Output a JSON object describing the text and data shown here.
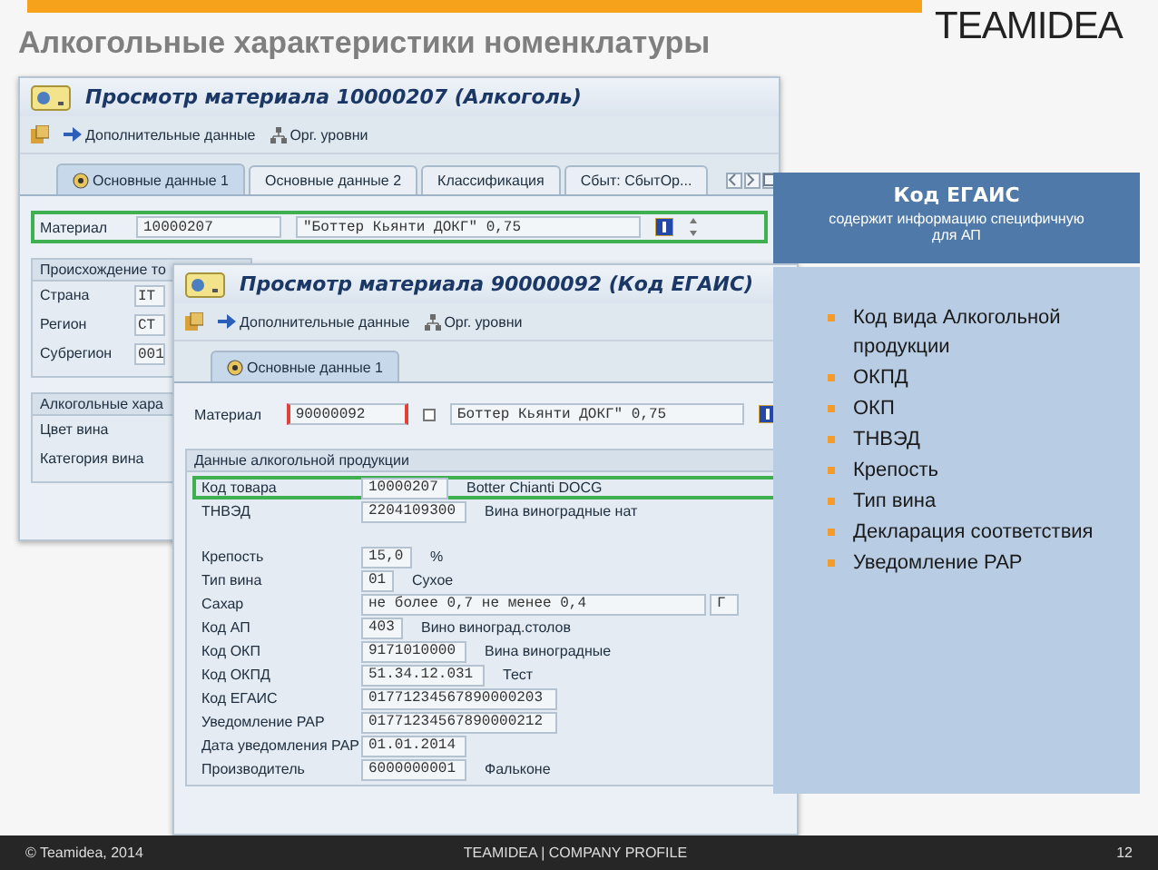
{
  "slide": {
    "title": "Алкогольные характеристики номенклатуры",
    "logo": "TEAMIDEA"
  },
  "back_window": {
    "title": "Просмотр материала 10000207 (Алкоголь)",
    "toolbar": [
      {
        "label": "Дополнительные данные"
      },
      {
        "label": "Орг. уровни"
      }
    ],
    "tabs": [
      {
        "label": "Основные данные 1",
        "selected": true
      },
      {
        "label": "Основные данные 2",
        "selected": false
      },
      {
        "label": "Классификация",
        "selected": false
      },
      {
        "label": "Сбыт: СбытОр...",
        "selected": false
      }
    ],
    "material": {
      "label": "Материал",
      "number": "10000207",
      "description": "\"Боттер Кьянти ДОКГ\" 0,75",
      "highlighted": true
    },
    "groups": [
      {
        "title": "Происхождение то",
        "fields": [
          {
            "label": "Страна",
            "value": "IT"
          },
          {
            "label": "Регион",
            "value": "CT"
          },
          {
            "label": "Субрегион",
            "value": "001"
          }
        ]
      },
      {
        "title": "Алкогольные хара",
        "fields": [
          {
            "label": "Цвет вина"
          },
          {
            "label": "Категория вина"
          }
        ]
      }
    ]
  },
  "front_window": {
    "title": "Просмотр материала 90000092 (Код ЕГАИС)",
    "toolbar": [
      {
        "label": "Дополнительные данные"
      },
      {
        "label": "Орг. уровни"
      }
    ],
    "tabs": [
      {
        "label": "Основные данные 1",
        "selected": true
      }
    ],
    "material": {
      "label": "Материал",
      "number": "90000092",
      "description": "Боттер Кьянти ДОКГ\" 0,75",
      "highlighted": false
    },
    "group": {
      "title": "Данные алкогольной продукции",
      "fields": [
        {
          "label": "Код товара",
          "value": "10000207",
          "text": "Botter Chianti DOCG",
          "highlighted": true
        },
        {
          "label": "ТНВЭД",
          "value": "2204109300",
          "text": "Вина виноградные нат",
          "highlighted": false
        },
        {
          "label": "Крепость",
          "value": "15,0",
          "text": "%",
          "highlighted": false,
          "gap_before": true
        },
        {
          "label": "Тип вина",
          "value": "01",
          "text": "Сухое",
          "highlighted": false
        },
        {
          "label": "Сахар",
          "value": "не более 0,7 не менее 0,4",
          "extra": "Г",
          "highlighted": false
        },
        {
          "label": "Код АП",
          "value": "403",
          "text": "Вино виноград.столов",
          "highlighted": false
        },
        {
          "label": "Код ОКП",
          "value": "9171010000",
          "text": "Вина виноградные",
          "highlighted": false
        },
        {
          "label": "Код ОКПД",
          "value": "51.34.12.031",
          "text": "Тест",
          "highlighted": false
        },
        {
          "label": "Код ЕГАИС",
          "value": "01771234567890000203",
          "highlighted": false
        },
        {
          "label": "Уведомление РАР",
          "value": "01771234567890000212",
          "highlighted": false
        },
        {
          "label": "Дата уведомления РАР",
          "value": "01.01.2014",
          "highlighted": false
        },
        {
          "label": "Производитель",
          "value": "6000000001",
          "text": "Фальконе",
          "highlighted": false
        }
      ]
    }
  },
  "callout": {
    "title": "Код ЕГАИС",
    "subtitle": "содержит информацию специфичную для АП",
    "items": [
      "Код вида Алкогольной продукции",
      "ОКПД",
      "ОКП",
      "ТНВЭД",
      "Крепость",
      "Тип вина",
      "Декларация соответствия",
      "Уведомление РАР"
    ]
  },
  "footer": {
    "copyright": "© Teamidea, 2014",
    "center": "TEAMIDEA | COMPANY PROFILE",
    "page": "12"
  }
}
